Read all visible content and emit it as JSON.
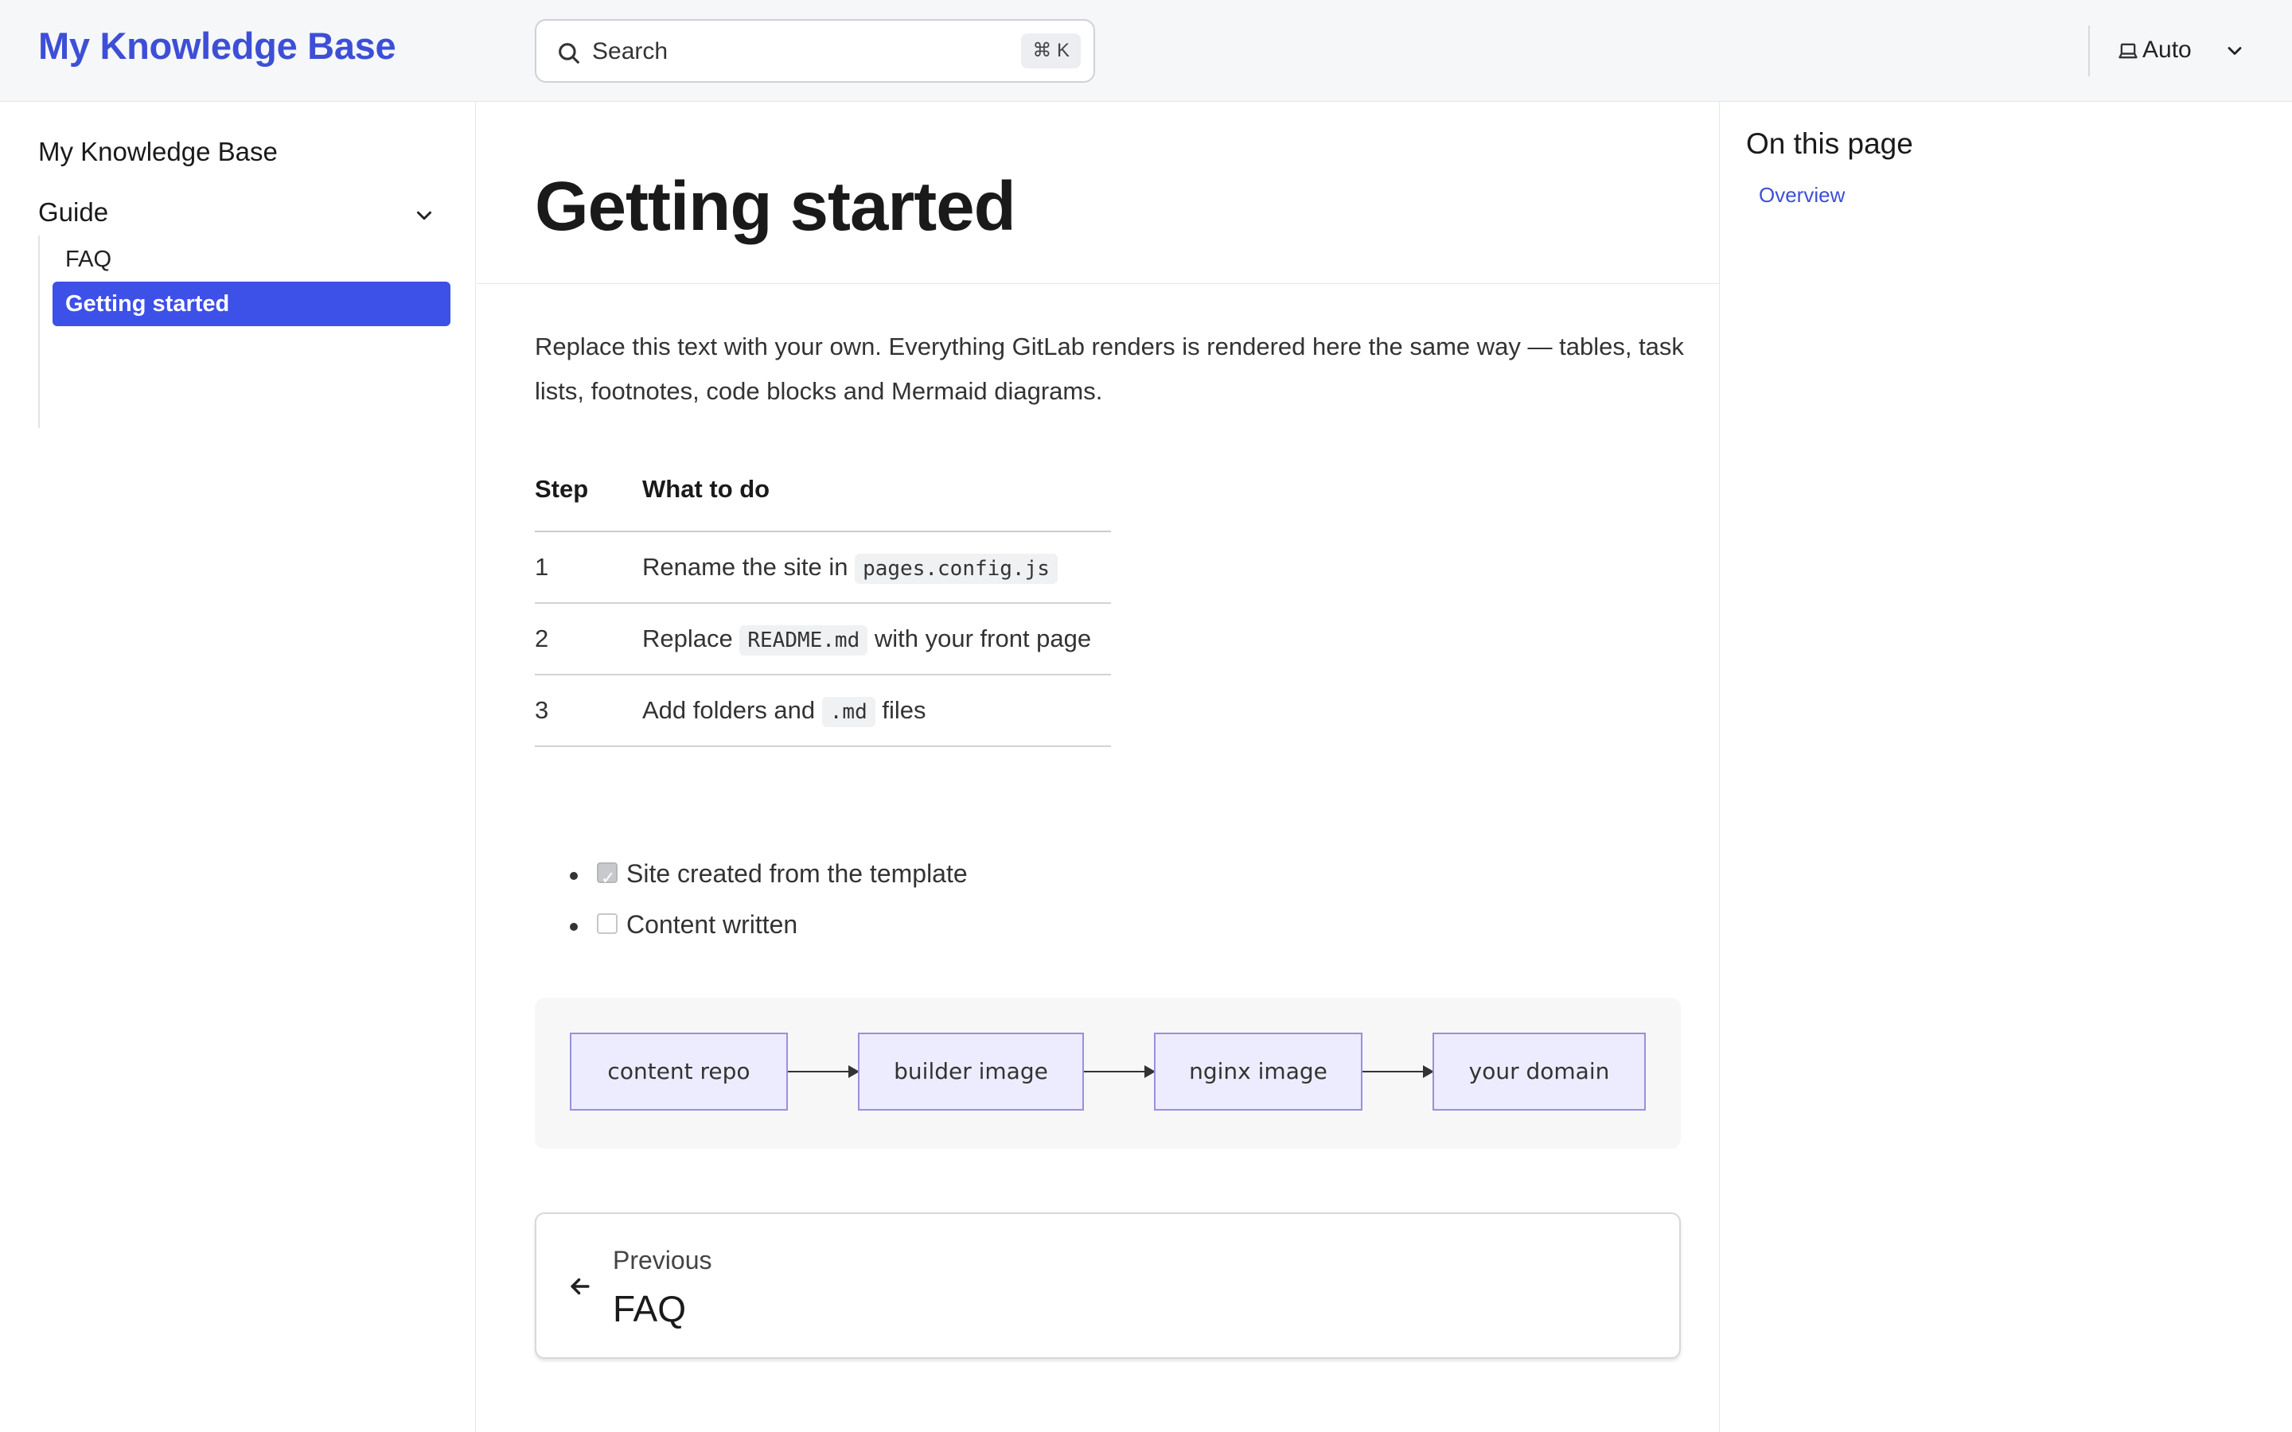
{
  "header": {
    "brand": "My Knowledge Base",
    "search_label": "Search",
    "search_shortcut": "⌘ K",
    "theme_label": "Auto"
  },
  "sidebar": {
    "title": "My Knowledge Base",
    "group": {
      "label": "Guide",
      "items": [
        {
          "label": "FAQ",
          "active": false
        },
        {
          "label": "Getting started",
          "active": true
        }
      ]
    }
  },
  "main": {
    "title": "Getting started",
    "intro": "Replace this text with your own. Everything GitLab renders is rendered here the same way — tables, task lists, footnotes, code blocks and Mermaid diagrams.",
    "table": {
      "headers": [
        "Step",
        "What to do"
      ],
      "rows": [
        {
          "step": "1",
          "before": "Rename the site in ",
          "code": "pages.config.js",
          "after": ""
        },
        {
          "step": "2",
          "before": "Replace ",
          "code": "README.md",
          "after": " with your front page"
        },
        {
          "step": "3",
          "before": "Add folders and ",
          "code": ".md",
          "after": " files"
        }
      ]
    },
    "tasks": [
      {
        "label": "Site created from the template",
        "checked": true
      },
      {
        "label": "Content written",
        "checked": false
      }
    ],
    "diagram": {
      "nodes": [
        "content repo",
        "builder image",
        "nginx image",
        "your domain"
      ]
    },
    "prev": {
      "label": "Previous",
      "title": "FAQ"
    }
  },
  "toc": {
    "title": "On this page",
    "links": [
      "Overview"
    ]
  },
  "colors": {
    "accent": "#3d4fd6",
    "active_nav": "#3d50e8",
    "diagram_node_fill": "#ececfe",
    "diagram_node_border": "#9a8fdd"
  }
}
